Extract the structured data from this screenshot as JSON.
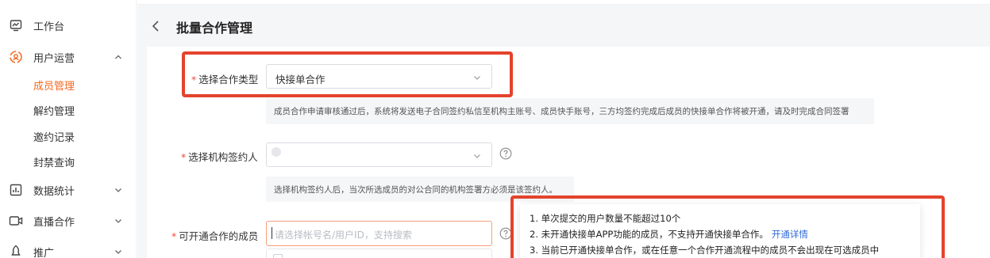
{
  "sidebar": {
    "items": [
      {
        "label": "工作台",
        "icon": "dashboard-icon"
      },
      {
        "label": "用户运营",
        "icon": "user-ops-icon"
      },
      {
        "label": "成员管理"
      },
      {
        "label": "解约管理"
      },
      {
        "label": "邀约记录"
      },
      {
        "label": "封禁查询"
      },
      {
        "label": "数据统计",
        "icon": "data-stats-icon"
      },
      {
        "label": "直播合作",
        "icon": "live-icon"
      },
      {
        "label": "推广",
        "icon": "promote-icon"
      }
    ],
    "accent_color": "#f26a21"
  },
  "header": {
    "title": "批量合作管理"
  },
  "form": {
    "coop_type": {
      "label": "选择合作类型",
      "value": "快接单合作",
      "hint": "成员合作申请审核通过后，系统将发送电子合同签约私信至机构主账号、成员快手账号，三方均签约完成后成员的快接单合作将被开通，请及时完成合同签署"
    },
    "signer": {
      "label": "选择机构签约人",
      "value": "",
      "hint": "选择机构签约人后，当次所选成员的对公合同的机构签署方必须是该签约人。"
    },
    "members": {
      "label": "可开通合作的成员",
      "placeholder": "请选择帐号名/用户ID，支持搜索"
    }
  },
  "tooltip": {
    "line1": "1. 单次提交的用户数量不能超过10个",
    "line2": "2. 未开通快接单APP功能的成员，不支持开通快接单合作。",
    "line2_link": "开通详情",
    "line3": "3. 当前已开通快接单合作，或在任意一个合作开通流程中的成员不会出现在可选成员中"
  },
  "colors": {
    "required": "#f04a3b",
    "link": "#2f6bd8",
    "highlight_box": "#e4432d"
  }
}
